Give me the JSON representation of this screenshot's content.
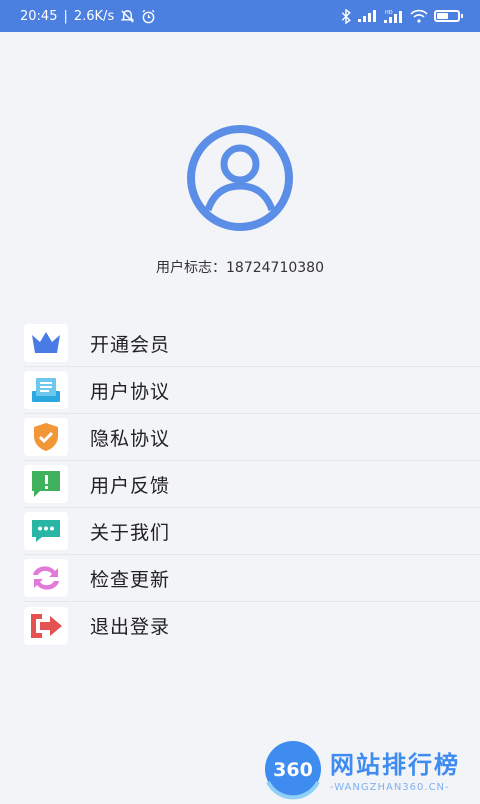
{
  "status_bar": {
    "time": "20:45",
    "network_speed": "2.6K/s",
    "icons": [
      "mute-icon",
      "alarm-icon",
      "bluetooth-icon",
      "signal-icon",
      "hd-signal-icon",
      "wifi-icon",
      "battery-icon"
    ],
    "battery_level": 0.55
  },
  "profile": {
    "avatar_icon": "user-avatar-icon",
    "user_id_text": "用户标志：18724710380"
  },
  "menu": {
    "items": [
      {
        "label": "开通会员",
        "icon": "crown-icon",
        "color": "#4a7be4"
      },
      {
        "label": "用户协议",
        "icon": "document-icon",
        "color": "#2ba8e0"
      },
      {
        "label": "隐私协议",
        "icon": "shield-icon",
        "color": "#f29737"
      },
      {
        "label": "用户反馈",
        "icon": "feedback-icon",
        "color": "#3fb15c"
      },
      {
        "label": "关于我们",
        "icon": "chat-icon",
        "color": "#29b6a4"
      },
      {
        "label": "检查更新",
        "icon": "refresh-icon",
        "color": "#e27ad8"
      },
      {
        "label": "退出登录",
        "icon": "logout-icon",
        "color": "#e55252"
      }
    ]
  },
  "watermark": {
    "logo_text": "360",
    "title": "网站排行榜",
    "subtitle": "-WANGZHAN360.CN-"
  },
  "colors": {
    "accent": "#4b7fe0",
    "background": "#f3f4f8"
  }
}
